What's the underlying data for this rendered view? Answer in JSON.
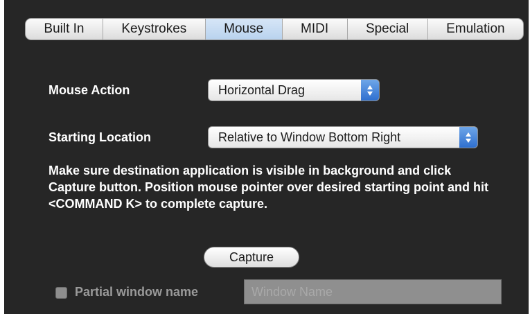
{
  "tabs": [
    {
      "label": "Built In",
      "selected": false
    },
    {
      "label": "Keystrokes",
      "selected": false
    },
    {
      "label": "Mouse",
      "selected": true
    },
    {
      "label": "MIDI",
      "selected": false
    },
    {
      "label": "Special",
      "selected": false
    },
    {
      "label": "Emulation",
      "selected": false
    }
  ],
  "mouse_action": {
    "label": "Mouse Action",
    "value": "Horizontal Drag"
  },
  "starting_location": {
    "label": "Starting Location",
    "value": "Relative to Window Bottom Right"
  },
  "instructions": "Make sure destination application is visible in background and click Capture button. Position mouse pointer over desired starting point and hit <COMMAND K> to complete capture.",
  "capture_button": "Capture",
  "partial_window": {
    "label": "Partial window name",
    "checked": false,
    "enabled": false,
    "placeholder": "Window Name",
    "value": ""
  },
  "colors": {
    "background": "#262626",
    "selected_tab": "#b9d2ee",
    "popup_arrows": "#2e6fcf",
    "label_text": "#ffffff",
    "disabled_text": "#9a9a9a"
  },
  "icons": {
    "popup_arrows": "up-down-chevron-icon"
  }
}
